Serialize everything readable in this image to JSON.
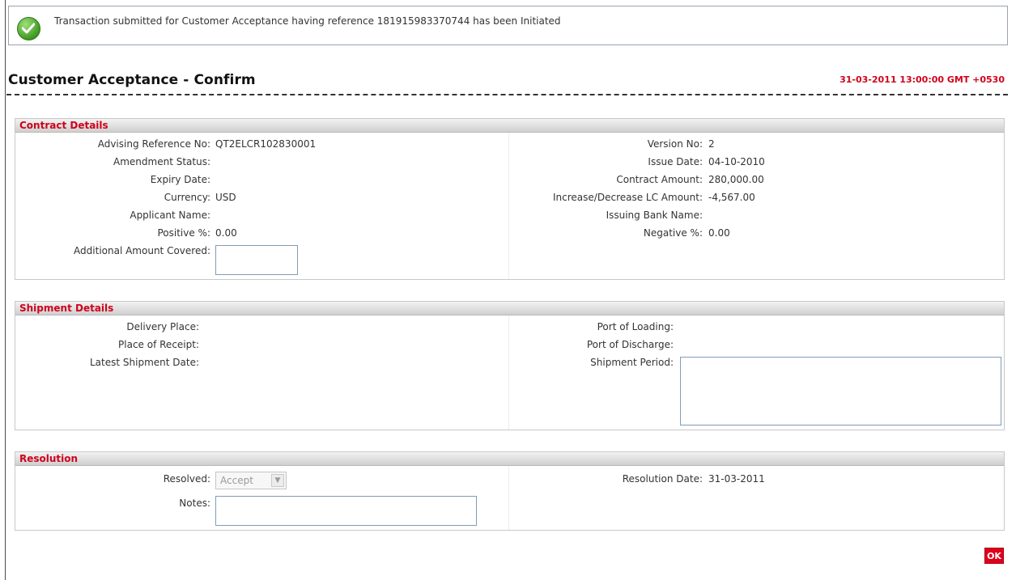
{
  "notice": {
    "message": "Transaction submitted for Customer Acceptance having reference 181915983370744 has been Initiated",
    "icon": "check-circle-icon"
  },
  "page": {
    "title": "Customer Acceptance - Confirm",
    "datetime": "31-03-2011 13:00:00 GMT +0530"
  },
  "contract": {
    "heading": "Contract Details",
    "advising_ref_label": "Advising Reference No:",
    "advising_ref_value": "QT2ELCR102830001",
    "amendment_status_label": "Amendment Status:",
    "expiry_date_label": "Expiry Date:",
    "currency_label": "Currency:",
    "currency_value": "USD",
    "applicant_name_label": "Applicant Name:",
    "positive_label": "Positive %:",
    "positive_value": "0.00",
    "additional_amount_label": "Additional Amount Covered:",
    "version_label": "Version No:",
    "version_value": "2",
    "issue_date_label": "Issue Date:",
    "issue_date_value": "04-10-2010",
    "contract_amount_label": "Contract Amount:",
    "contract_amount_value": "280,000.00",
    "incdec_label": "Increase/Decrease LC Amount:",
    "incdec_value": "-4,567.00",
    "issuing_bank_label": "Issuing Bank Name:",
    "negative_label": "Negative %:",
    "negative_value": "0.00"
  },
  "shipment": {
    "heading": "Shipment Details",
    "delivery_place_label": "Delivery Place:",
    "place_of_receipt_label": "Place of Receipt:",
    "latest_shipment_label": "Latest Shipment Date:",
    "port_loading_label": "Port of Loading:",
    "port_discharge_label": "Port of Discharge:",
    "shipment_period_label": "Shipment Period:"
  },
  "resolution": {
    "heading": "Resolution",
    "resolved_label": "Resolved:",
    "resolved_value": "Accept",
    "notes_label": "Notes:",
    "resolution_date_label": "Resolution Date:",
    "resolution_date_value": "31-03-2011"
  },
  "actions": {
    "ok_label": "OK"
  },
  "colors": {
    "accent": "#d0021b",
    "success": "#3f9a20"
  }
}
